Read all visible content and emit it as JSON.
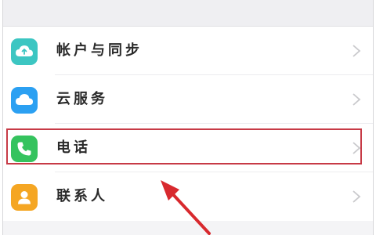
{
  "settings_list": {
    "items": [
      {
        "label": "帐户与同步",
        "icon": "cloud-sync-icon",
        "icon_color": "#3cc6c2",
        "chevron": "chevron-right-icon"
      },
      {
        "label": "云服务",
        "icon": "cloud-icon",
        "icon_color": "#2ba0f2",
        "chevron": "chevron-right-icon"
      },
      {
        "label": "电话",
        "icon": "phone-icon",
        "icon_color": "#35c35e",
        "chevron": "chevron-right-icon"
      },
      {
        "label": "联系人",
        "icon": "contacts-icon",
        "icon_color": "#f5a623",
        "chevron": "chevron-right-icon"
      }
    ]
  },
  "annotation": {
    "highlight_color": "#c73a46",
    "arrow_color": "#d8292e",
    "highlighted_item": "电话"
  }
}
